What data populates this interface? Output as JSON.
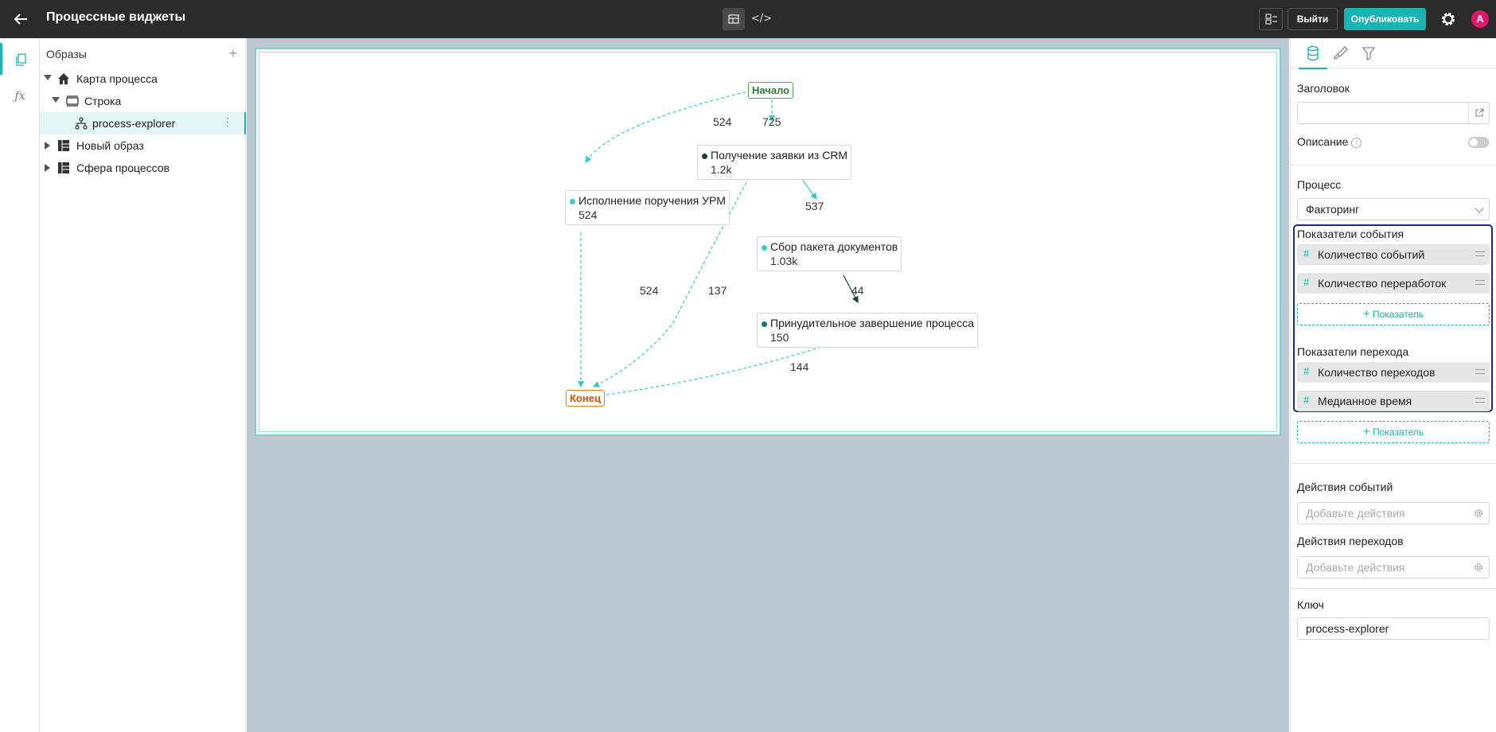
{
  "header": {
    "back_icon": "arrow-left-icon",
    "title": "Процессные виджеты",
    "mode_visual_icon": "layout-icon",
    "mode_code_label": "</>",
    "exit_label": "Выйти",
    "publish_label": "Опубликовать",
    "avatar_letter": "А",
    "accent_color": "#1bb3b3",
    "avatar_color": "#e0176b"
  },
  "rail": {
    "items": [
      {
        "icon": "pages-icon"
      },
      {
        "icon": "function-icon",
        "label": "ƒx"
      }
    ]
  },
  "tree": {
    "title": "Образы",
    "add_label": "+",
    "items": [
      {
        "label": "Карта процесса",
        "icon": "home-icon",
        "expanded": true
      },
      {
        "label": "Строка",
        "icon": "row-icon",
        "expanded": true
      },
      {
        "label": "process-explorer",
        "icon": "hierarchy-icon",
        "selected": true
      },
      {
        "label": "Новый образ",
        "icon": "table-icon",
        "expanded": false
      },
      {
        "label": "Сфера процессов",
        "icon": "table-icon",
        "expanded": false
      }
    ]
  },
  "graph": {
    "start_label": "Начало",
    "end_label": "Конец",
    "nodes": [
      {
        "id": "crm",
        "name": "Получение заявки из CRM",
        "count": "1.2k",
        "dot_color": "#1d3b3b"
      },
      {
        "id": "urm",
        "name": "Исполнение поручения УРМ",
        "count": "524",
        "dot_color": "#3ec8c8"
      },
      {
        "id": "docs",
        "name": "Сбор пакета документов",
        "count": "1.03k",
        "dot_color": "#3ec8c8"
      },
      {
        "id": "force",
        "name": "Принудительное завершение процесса",
        "count": "150",
        "dot_color": "#1d7070"
      }
    ],
    "edges": [
      {
        "label": "524"
      },
      {
        "label": "725"
      },
      {
        "label": "537"
      },
      {
        "label": "524"
      },
      {
        "label": "137"
      },
      {
        "label": "44"
      },
      {
        "label": "144"
      }
    ]
  },
  "panel": {
    "tabs": [
      "database-icon",
      "brush-icon",
      "filter-icon"
    ],
    "header_label": "Заголовок",
    "header_value": "",
    "description_label": "Описание",
    "process_label": "Процесс",
    "process_value": "Факторинг",
    "event_metrics_label": "Показатели события",
    "event_metrics": [
      "Количество событий",
      "Количество переработок"
    ],
    "transition_metrics_label": "Показатели перехода",
    "transition_metrics": [
      "Количество переходов",
      "Медианное время"
    ],
    "add_metric_label": "Показатель",
    "event_actions_label": "Действия событий",
    "transition_actions_label": "Действия переходов",
    "actions_placeholder": "Добавьте действия",
    "key_label": "Ключ",
    "key_value": "process-explorer"
  }
}
